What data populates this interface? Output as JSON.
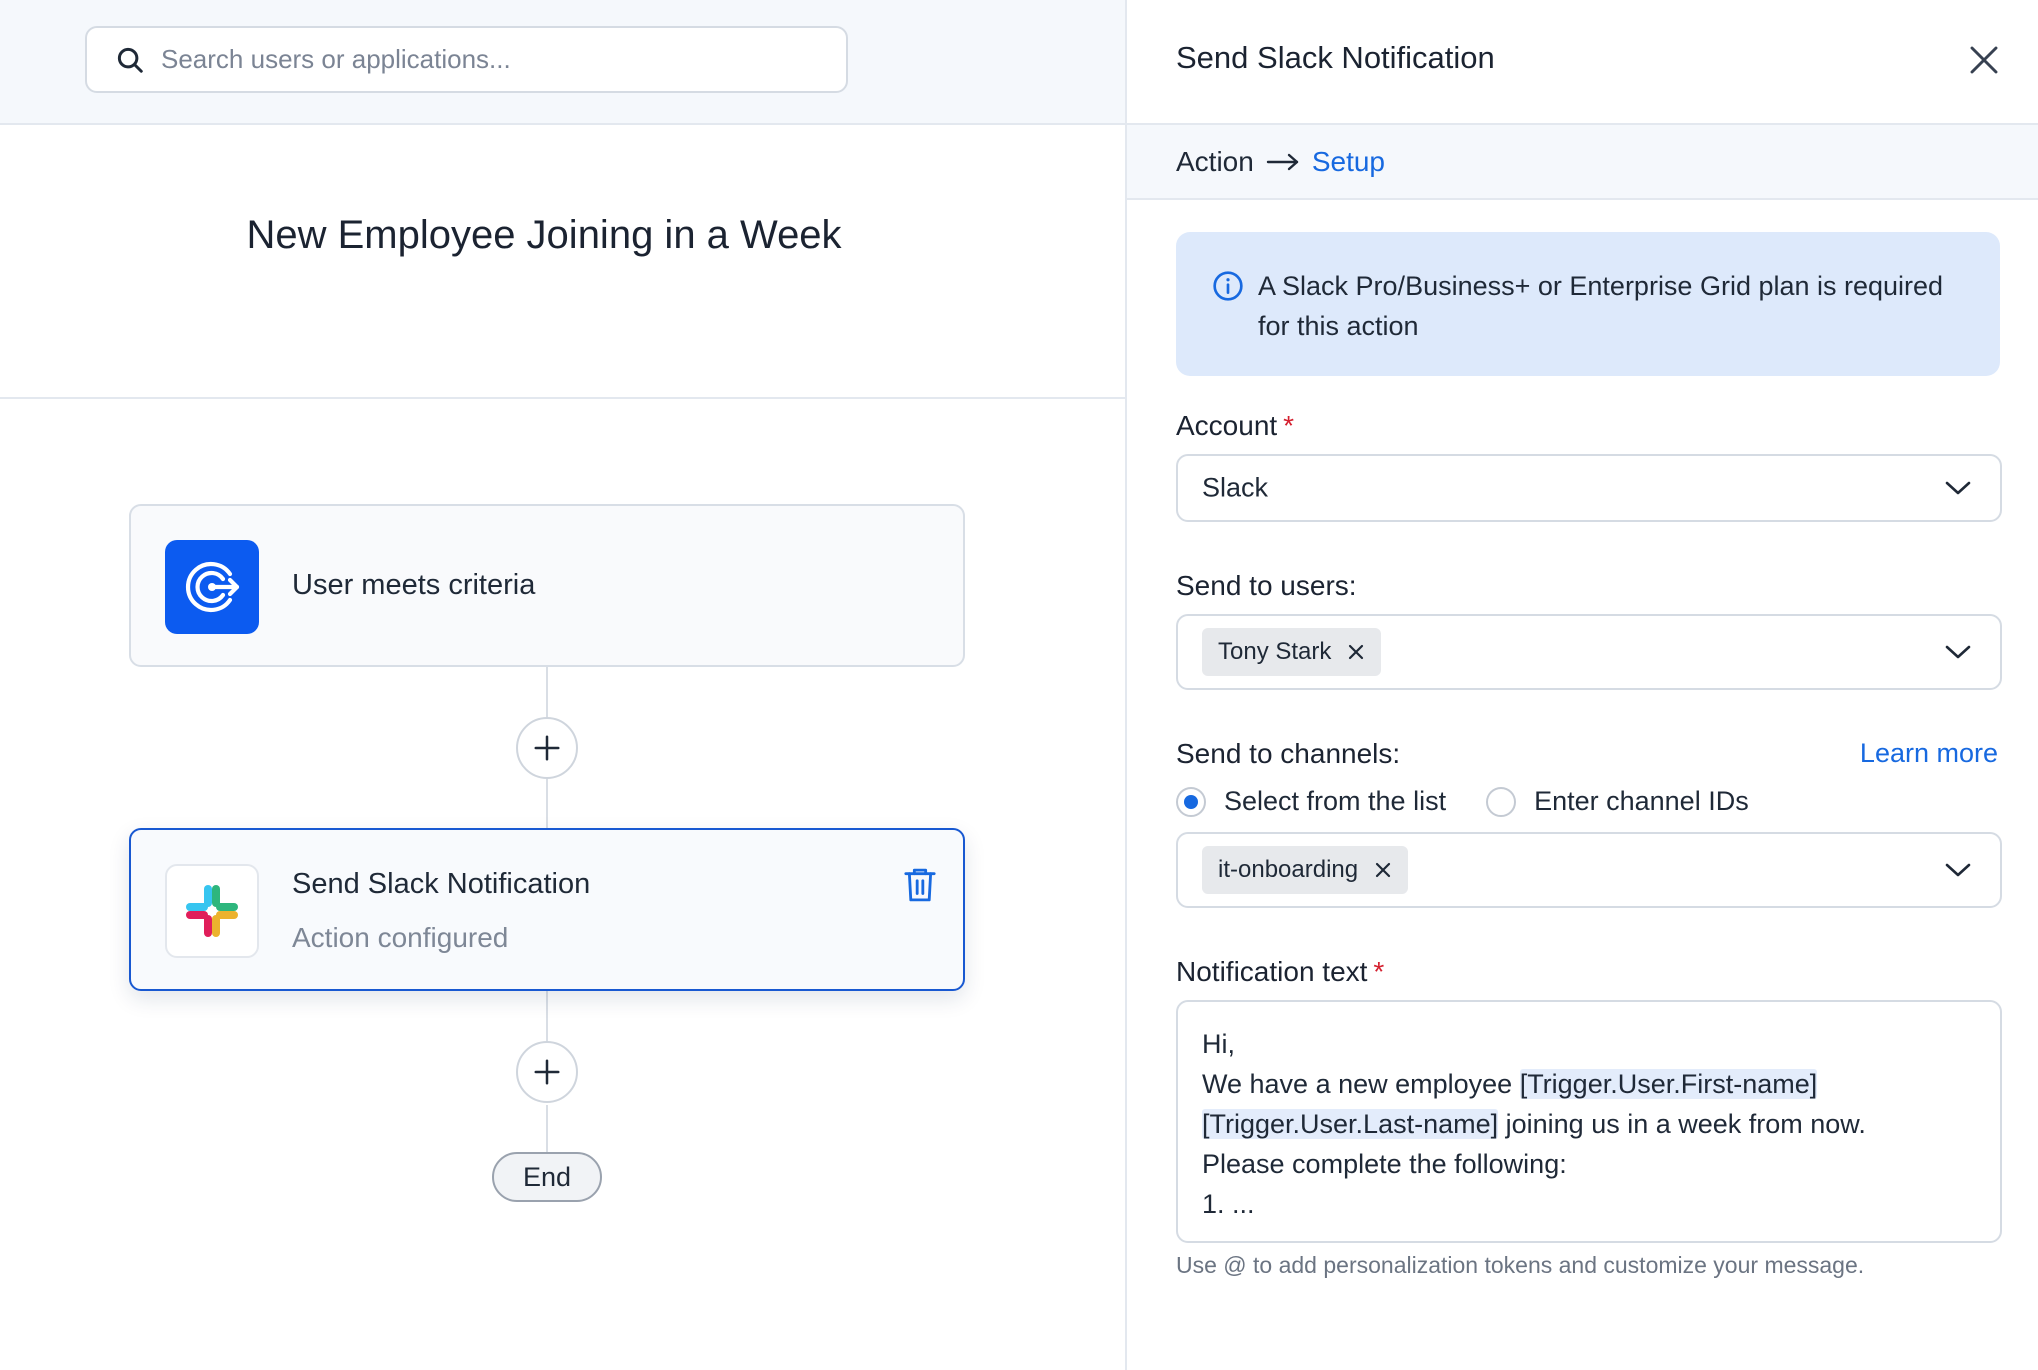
{
  "search": {
    "placeholder": "Search users or applications..."
  },
  "workflow": {
    "title": "New Employee Joining in a Week",
    "nodes": [
      {
        "title": "User meets criteria",
        "icon": "target-arrow-icon"
      },
      {
        "title": "Send Slack Notification",
        "subtitle": "Action configured",
        "icon": "slack-logo-icon"
      }
    ],
    "end_label": "End"
  },
  "panel": {
    "title": "Send Slack Notification",
    "breadcrumb": {
      "step1": "Action",
      "step2": "Setup"
    },
    "info": "A Slack Pro/Business+ or Enterprise Grid plan is required for this action",
    "account": {
      "label": "Account",
      "required_mark": "*",
      "value": "Slack"
    },
    "send_to_users": {
      "label": "Send to users:",
      "chips": [
        "Tony Stark"
      ]
    },
    "send_to_channels": {
      "label": "Send to channels:",
      "learn_more": "Learn more",
      "options": [
        "Select from the list",
        "Enter channel IDs"
      ],
      "selected_option": "Select from the list",
      "chips": [
        "it-onboarding"
      ]
    },
    "notification": {
      "label": "Notification text",
      "required_mark": "*",
      "line1": "Hi,",
      "line2_prefix": "We have a new employee ",
      "token_first": "[Trigger.User.First-name]",
      "token_last": "[Trigger.User.Last-name]",
      "line3_suffix": " joining us in a week from now.",
      "line4": "Please complete the following:",
      "line5": "1. ...",
      "hint": "Use @ to add personalization tokens and customize your message."
    }
  },
  "colors": {
    "accent": "#1769e0",
    "brand_blue": "#0c5bf0",
    "info_bg": "#dde9fb",
    "required": "#d4202f"
  }
}
